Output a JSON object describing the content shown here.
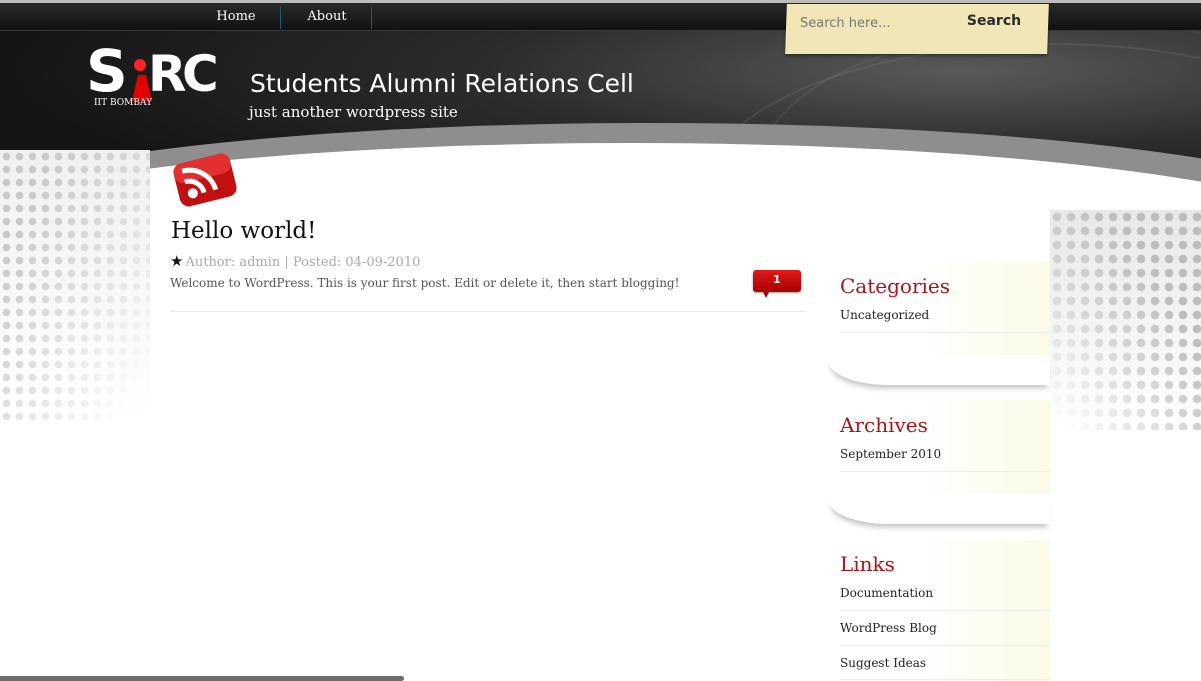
{
  "nav": {
    "items": [
      {
        "label": "Home"
      },
      {
        "label": "About"
      }
    ]
  },
  "search": {
    "placeholder": "Search here...",
    "button_label": "Search"
  },
  "header": {
    "logo_subtext": "IIT BOMBAY",
    "title": "Students Alumni Relations Cell",
    "tagline": "just another wordpress site"
  },
  "post": {
    "title": "Hello world!",
    "meta": "Author: admin | Posted: 04-09-2010",
    "excerpt": "Welcome to WordPress. This is your first post. Edit or delete it, then start blogging!",
    "comment_count": "1"
  },
  "sidebar": {
    "categories": {
      "title": "Categories",
      "items": [
        "Uncategorized"
      ]
    },
    "archives": {
      "title": "Archives",
      "items": [
        "September 2010"
      ]
    },
    "links": {
      "title": "Links",
      "items": [
        "Documentation",
        "WordPress Blog",
        "Suggest Ideas"
      ]
    }
  },
  "colors": {
    "accent_red": "#a8151b",
    "search_bg": "#f1e6b5",
    "badge_red": "#d01010"
  },
  "icons": {
    "rss": "rss-feed-icon",
    "star": "star-icon",
    "comment": "comment-bubble-icon"
  }
}
